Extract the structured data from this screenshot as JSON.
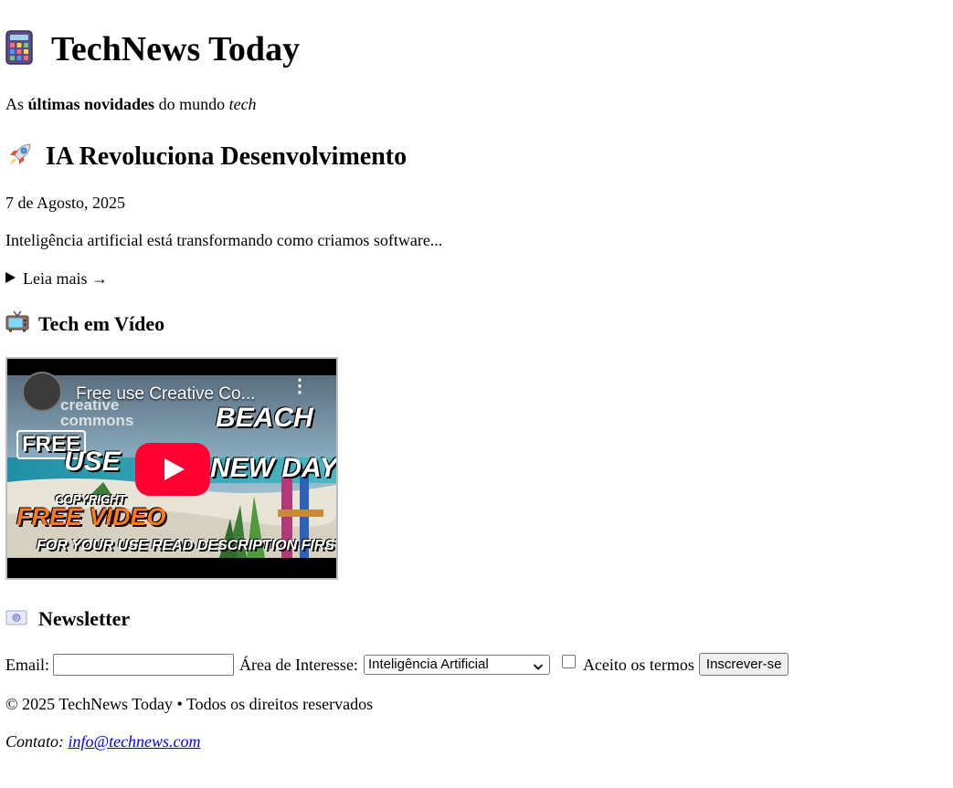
{
  "header": {
    "title": "TechNews Today",
    "tagline_prefix": "As ",
    "tagline_bold": "últimas novidades",
    "tagline_middle": " do mundo ",
    "tagline_italic": "tech",
    "icon": "calculator-icon"
  },
  "article": {
    "icon": "rocket-icon",
    "title": "IA Revoluciona Desenvolvimento",
    "date": "7 de Agosto, 2025",
    "excerpt": "Inteligência artificial está transformando como criamos software...",
    "details_label": "Leia mais →"
  },
  "video_section": {
    "icon": "tv-icon",
    "heading": "Tech em Vídeo",
    "video": {
      "title": "Free use Creative Co...",
      "channel_text": "creative commons",
      "thumbnail_lines": [
        "BEACH",
        "FREE",
        "USE",
        "NEW DAYS",
        "COPYRIGHT",
        "FREE VIDEO",
        "FOR YOUR USE READ DESCRIPTION FIRST"
      ]
    }
  },
  "newsletter": {
    "icon": "envelope-icon",
    "heading": "Newsletter",
    "email_label": "Email:",
    "email_value": "",
    "interest_label": "Área de Interesse:",
    "interest_selected": "Inteligência Artificial",
    "terms_label": "Aceito os termos",
    "terms_checked": false,
    "submit_label": "Inscrever-se"
  },
  "footer": {
    "copyright": "© 2025 TechNews Today • Todos os direitos reservados",
    "contact_label": "Contato:",
    "contact_email": "info@technews.com"
  },
  "colors": {
    "link": "#0000ee",
    "youtube_red": "#ff0033"
  }
}
